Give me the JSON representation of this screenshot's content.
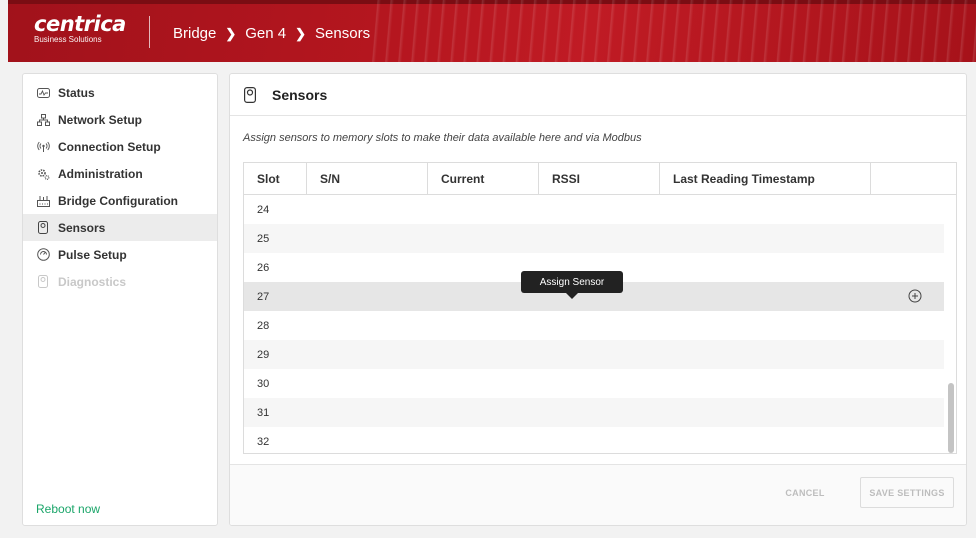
{
  "header": {
    "brand": "centrica",
    "brand_sub": "Business Solutions",
    "breadcrumb": [
      "Bridge",
      "Gen 4",
      "Sensors"
    ],
    "breadcrumb_sep": "❯",
    "color": "#b5161f"
  },
  "sidebar": {
    "items": [
      {
        "label": "Status",
        "icon": "status-icon"
      },
      {
        "label": "Network Setup",
        "icon": "network-icon"
      },
      {
        "label": "Connection Setup",
        "icon": "wireless-icon"
      },
      {
        "label": "Administration",
        "icon": "gears-icon"
      },
      {
        "label": "Bridge Configuration",
        "icon": "bridge-icon"
      },
      {
        "label": "Sensors",
        "icon": "sensor-icon",
        "active": true
      },
      {
        "label": "Pulse Setup",
        "icon": "pulse-icon"
      },
      {
        "label": "Diagnostics",
        "icon": "diagnostics-icon",
        "disabled": true
      }
    ],
    "reboot_label": "Reboot now",
    "reboot_color": "#1aa569"
  },
  "main": {
    "title": "Sensors",
    "description": "Assign sensors to memory slots to make their data available here and via Modbus",
    "columns": [
      "Slot",
      "S/N",
      "Current",
      "RSSI",
      "Last Reading Timestamp",
      ""
    ],
    "rows": [
      "24",
      "25",
      "26",
      "27",
      "28",
      "29",
      "30",
      "31",
      "32"
    ],
    "hover_row": "27",
    "tooltip": "Assign Sensor",
    "cancel_label": "CANCEL",
    "save_label": "SAVE SETTINGS"
  }
}
